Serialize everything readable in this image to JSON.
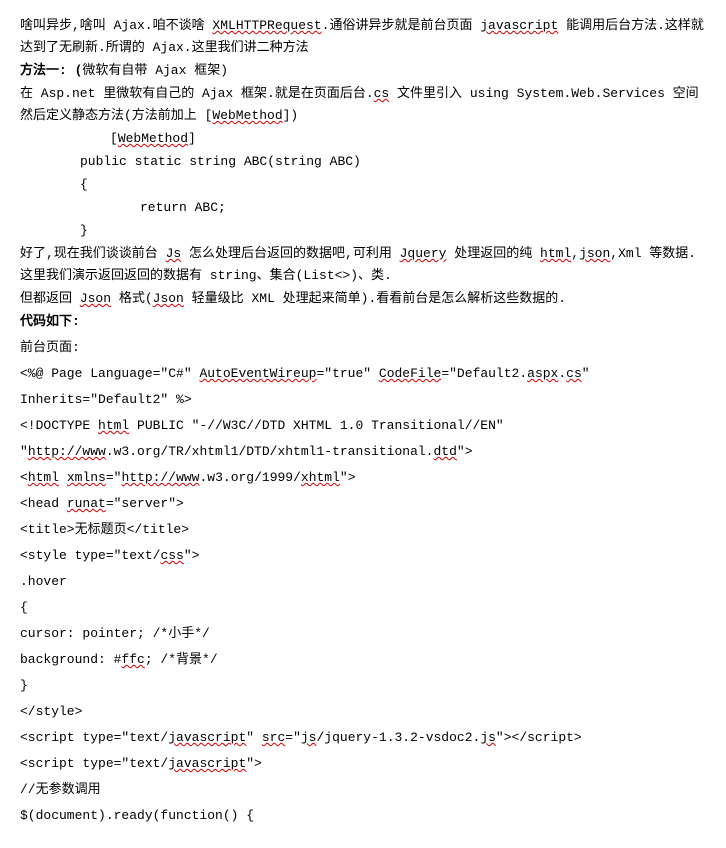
{
  "p1_a": "啥叫异步,啥叫 Ajax.咱不谈啥 ",
  "p1_b": "XMLHTTPRequest",
  "p1_c": ".通俗讲异步就是前台页面 ",
  "p1_d": "javascript",
  "p1_e": " 能调用后台方法.这样就达到了无刷新.所谓的 Ajax.这里我们讲二种方法",
  "m1_a": "方法一: (",
  "m1_b": "微软有自带 Ajax 框架)",
  "p2_a": "在 Asp.net 里微软有自己的 Ajax 框架.就是在页面后台.",
  "p2_b": "cs",
  "p2_c": " 文件里引入 using System.Web.Services 空间 然后定义静态方法(方法前加上  [",
  "p2_d": "WebMethod",
  "p2_e": "])",
  "code1_a": "[",
  "code1_b": "WebMethod",
  "code1_c": "]",
  "code2": "public static string ABC(string ABC)",
  "code3": "{",
  "code4": "return ABC;",
  "code5": "}",
  "p3_a": "好了,现在我们谈谈前台 ",
  "p3_b": "Js",
  "p3_c": " 怎么处理后台返回的数据吧,可利用 ",
  "p3_d": "Jquery",
  "p3_e": " 处理返回的纯 ",
  "p3_f": "html",
  "p3_g": ",",
  "p3_h": "json",
  "p3_i": ",Xml 等数据.这里我们演示返回返回的数据有 string、集合(List<>)、类.",
  "p4_a": "但都返回 ",
  "p4_b": "Json",
  "p4_c": " 格式(",
  "p4_d": "Json",
  "p4_e": " 轻量级比 XML 处理起来简单).看看前台是怎么解析这些数据的.",
  "hdr": "代码如下:",
  "fp": "前台页面:",
  "l1_a": "<%@ Page Language=\"C#\" ",
  "l1_b": "AutoEventWireup",
  "l1_c": "=\"true\" ",
  "l1_d": "CodeFile",
  "l1_e": "=\"Default2.",
  "l1_f": "aspx",
  "l1_g": ".",
  "l1_h": "cs",
  "l1_i": "\"",
  "l2": "Inherits=\"Default2\" %>",
  "l3_a": "<!DOCTYPE ",
  "l3_b": "html",
  "l3_c": " PUBLIC \"-//W3C//DTD XHTML 1.0 Transitional//EN\"",
  "l4_a": "\"",
  "l4_b": "http://www",
  "l4_c": ".w3.org/TR/xhtml1/DTD/xhtml1-transitional.",
  "l4_d": "dtd",
  "l4_e": "\">",
  "l5_a": "<",
  "l5_b": "html",
  "l5_c": " ",
  "l5_d": "xmlns",
  "l5_e": "=\"",
  "l5_f": "http://www",
  "l5_g": ".w3.org/1999/",
  "l5_h": "xhtml",
  "l5_i": "\">",
  "l6_a": "<head ",
  "l6_b": "runat",
  "l6_c": "=\"server\">",
  "l7": "<title>无标题页</title>",
  "l8_a": "<style type=\"text/",
  "l8_b": "css",
  "l8_c": "\">",
  "l9": ".hover",
  "l10": "{",
  "l11": "cursor: pointer; /*小手*/",
  "l12_a": "background: #",
  "l12_b": "ffc",
  "l12_c": "; /*背景*/",
  "l13": "}",
  "l14": "</style>",
  "l15_a": "<script type=\"text/",
  "l15_b": "javascript",
  "l15_c": "\" ",
  "l15_d": "src",
  "l15_e": "=\"",
  "l15_f": "js",
  "l15_g": "/jquery-1.3.2-vsdoc2.",
  "l15_h": "js",
  "l15_i": "\"></script>",
  "l16_a": "<script type=\"text/",
  "l16_b": "javascript",
  "l16_c": "\">",
  "l17": "//无参数调用",
  "l18": "$(document).ready(function() {"
}
